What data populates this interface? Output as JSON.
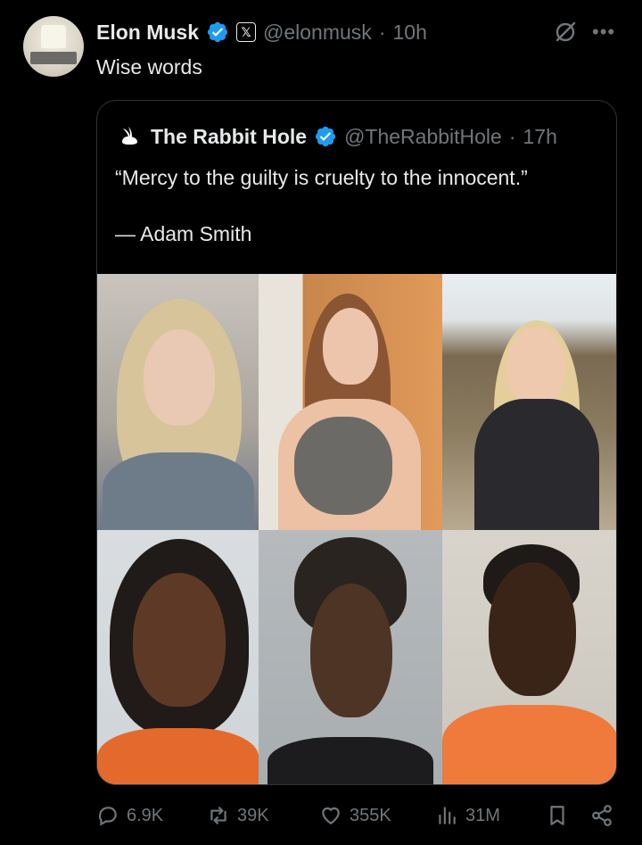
{
  "post": {
    "author_name": "Elon Musk",
    "handle": "@elonmusk",
    "separator": "·",
    "time": "10h",
    "text": "Wise words"
  },
  "quote": {
    "author_name": "The Rabbit Hole",
    "handle": "@TheRabbitHole",
    "separator": "·",
    "time": "17h",
    "text": "“Mercy to the guilty is cruelty to the innocent.”",
    "attribution": "— Adam Smith"
  },
  "actions": {
    "replies": "6.9K",
    "reposts": "39K",
    "likes": "355K",
    "views": "31M"
  },
  "colors": {
    "background": "#000000",
    "text": "#e7e9ea",
    "muted": "#71767b",
    "verified": "#1d9bf0",
    "border": "#2f3336"
  },
  "icons": [
    "verified-icon",
    "x-badge-icon",
    "grok-icon",
    "more-icon",
    "rabbit-logo-icon",
    "reply-icon",
    "repost-icon",
    "like-icon",
    "views-icon",
    "bookmark-icon",
    "share-icon"
  ]
}
